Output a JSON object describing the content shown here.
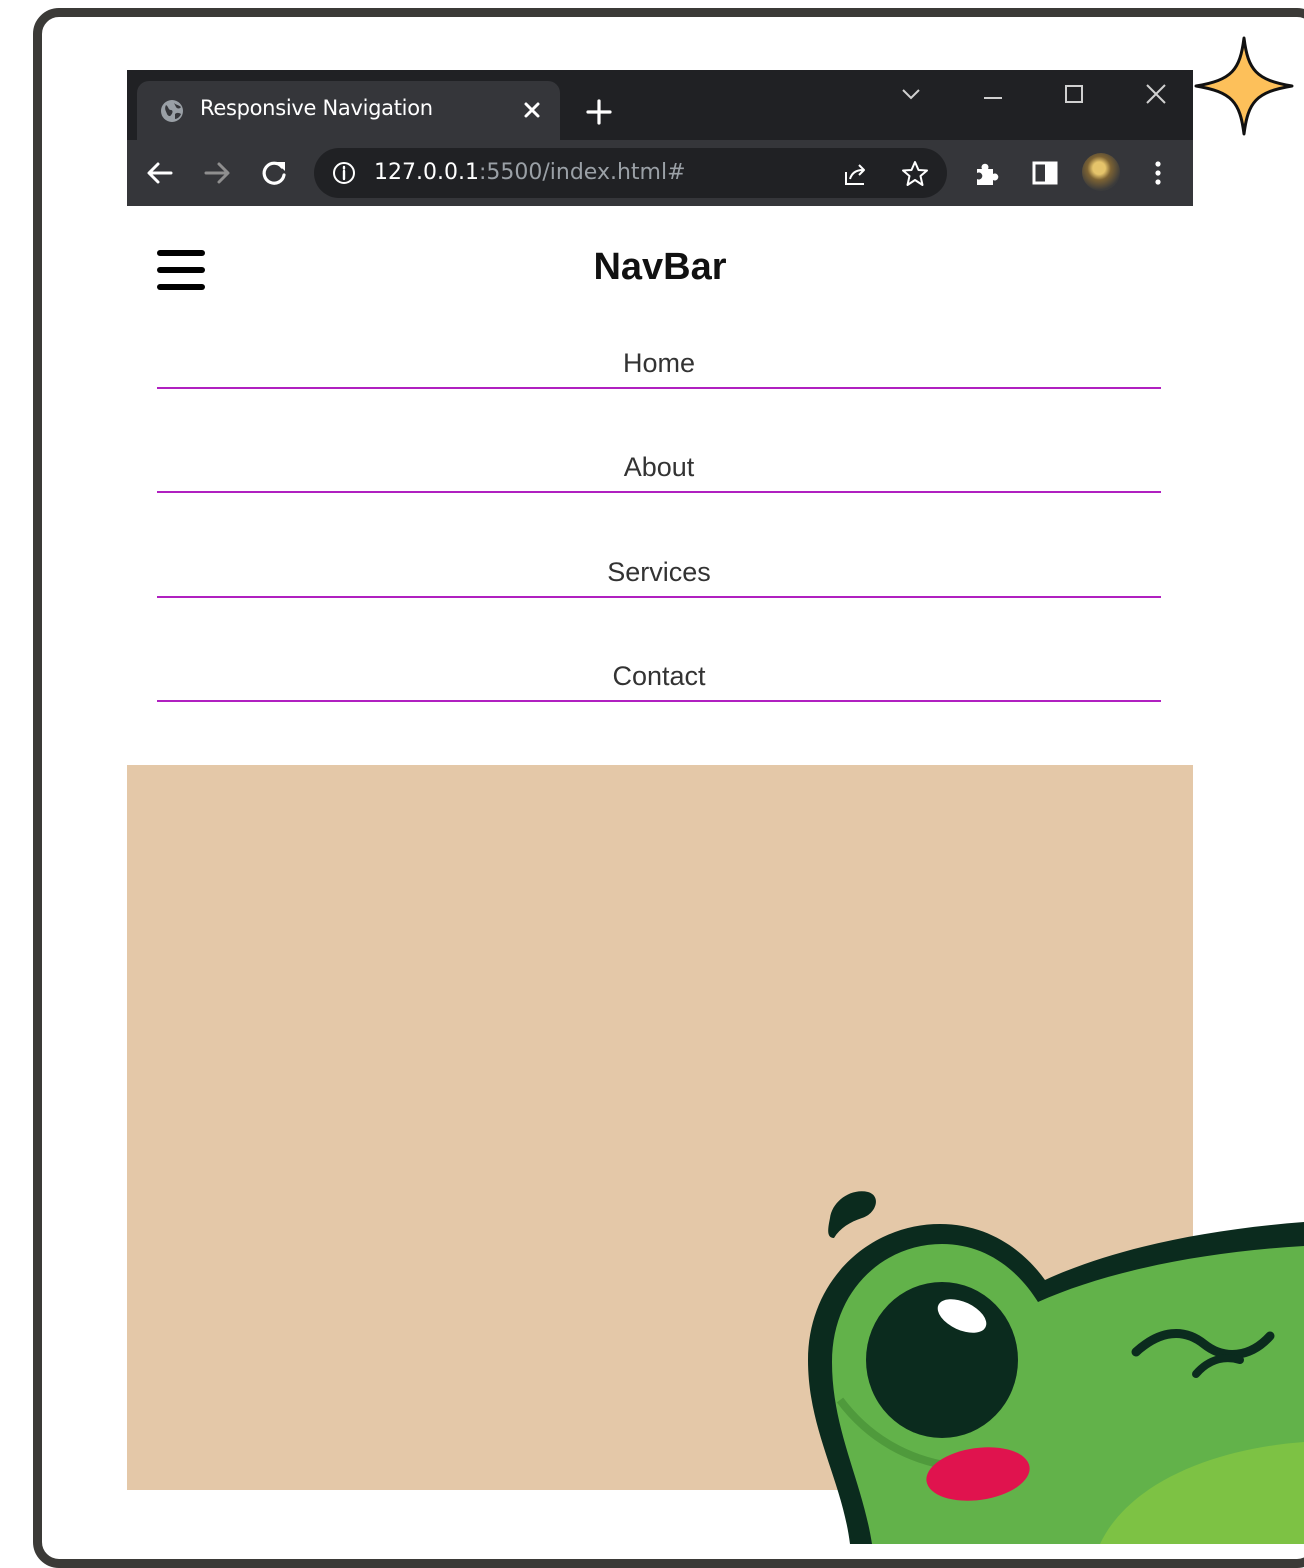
{
  "browser": {
    "tab_title": "Responsive Navigation",
    "url_host": "127.0.0.1",
    "url_path": ":5500/index.html#"
  },
  "page": {
    "brand": "NavBar",
    "nav_items": [
      "Home",
      "About",
      "Services",
      "Contact"
    ]
  },
  "colors": {
    "hero_background": "#e4c8a8",
    "nav_underline": "#b020c0",
    "chrome_dark": "#202124",
    "chrome_toolbar": "#35363a"
  },
  "icons": [
    "globe-icon",
    "close-tab-icon",
    "new-tab-icon",
    "tab-search-icon",
    "minimize-icon",
    "maximize-icon",
    "close-window-icon",
    "back-icon",
    "forward-icon",
    "reload-icon",
    "info-icon",
    "share-icon",
    "star-icon",
    "extensions-icon",
    "side-panel-icon",
    "kebab-menu-icon",
    "hamburger-menu-icon",
    "sparkle-icon"
  ]
}
